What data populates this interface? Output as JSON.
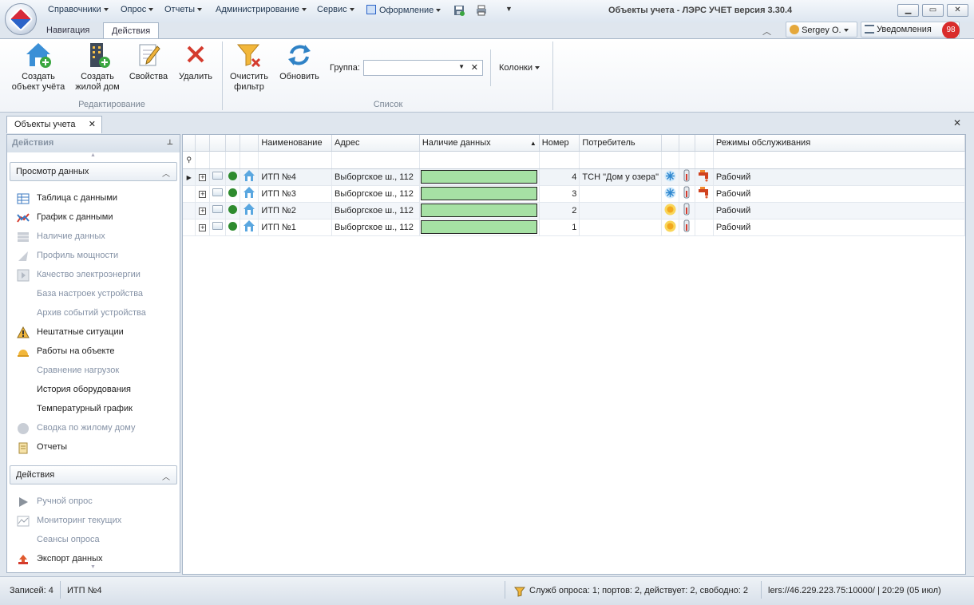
{
  "window": {
    "title": "Объекты учета - ЛЭРС УЧЕТ версия 3.30.4"
  },
  "menu": [
    "Справочники",
    "Опрос",
    "Отчеты",
    "Администрирование",
    "Сервис",
    "Оформление"
  ],
  "ribbon_tabs": [
    "Навигация",
    "Действия"
  ],
  "user": {
    "name": "Sergey O.",
    "notifications_label": "Уведомления",
    "notifications_count": "98"
  },
  "ribbon": {
    "create_object": [
      "Создать",
      "объект учёта"
    ],
    "create_house": [
      "Создать",
      "жилой дом"
    ],
    "properties": "Свойства",
    "delete": "Удалить",
    "clear_filter": [
      "Очистить",
      "фильтр"
    ],
    "refresh": "Обновить",
    "group_label": "Группа:",
    "group_value": "",
    "columns": "Колонки",
    "group_edit": "Редактирование",
    "group_list": "Список"
  },
  "doc_tab": {
    "label": "Объекты учета"
  },
  "left_panel": {
    "header": "Действия",
    "section_view": "Просмотр данных",
    "view_items": [
      {
        "label": "Таблица с данными",
        "icon": "table-icon",
        "enabled": true
      },
      {
        "label": "График с данными",
        "icon": "chart-icon",
        "enabled": true
      },
      {
        "label": "Наличие данных",
        "icon": "data-availability-icon",
        "enabled": false
      },
      {
        "label": "Профиль мощности",
        "icon": "power-profile-icon",
        "enabled": false
      },
      {
        "label": "Качество электроэнергии",
        "icon": "power-quality-icon",
        "enabled": false
      },
      {
        "label": "База настроек устройства",
        "icon": "",
        "enabled": false
      },
      {
        "label": "Архив событий устройства",
        "icon": "",
        "enabled": false
      },
      {
        "label": "Нештатные ситуации",
        "icon": "warning-icon",
        "enabled": true
      },
      {
        "label": "Работы на объекте",
        "icon": "hardhat-icon",
        "enabled": true
      },
      {
        "label": "Сравнение нагрузок",
        "icon": "",
        "enabled": false
      },
      {
        "label": "История оборудования",
        "icon": "",
        "enabled": true
      },
      {
        "label": "Температурный график",
        "icon": "",
        "enabled": true
      },
      {
        "label": "Сводка по жилому дому",
        "icon": "house-summary-icon",
        "enabled": false
      },
      {
        "label": "Отчеты",
        "icon": "report-icon",
        "enabled": true
      }
    ],
    "section_actions": "Действия",
    "action_items": [
      {
        "label": "Ручной опрос",
        "icon": "play-icon",
        "enabled": false
      },
      {
        "label": "Мониторинг текущих",
        "icon": "monitoring-icon",
        "enabled": false
      },
      {
        "label": "Сеансы опроса",
        "icon": "",
        "enabled": false
      },
      {
        "label": "Экспорт данных",
        "icon": "export-icon",
        "enabled": true
      }
    ]
  },
  "grid": {
    "columns": [
      "Наименование",
      "Адрес",
      "Наличие данных",
      "Номер",
      "Потребитель",
      "Режимы обслуживания"
    ],
    "rows": [
      {
        "name": "ИТП №4",
        "address": "Выборгское ш., 112",
        "number": "4",
        "consumer": "ТСН \"Дом у озера\"",
        "mode": "Рабочий",
        "season": "winter",
        "has_tap": true,
        "data_fill": 1.0
      },
      {
        "name": "ИТП №3",
        "address": "Выборгское ш., 112",
        "number": "3",
        "consumer": "",
        "mode": "Рабочий",
        "season": "winter",
        "has_tap": true,
        "data_fill": 1.0
      },
      {
        "name": "ИТП №2",
        "address": "Выборгское ш., 112",
        "number": "2",
        "consumer": "",
        "mode": "Рабочий",
        "season": "summer",
        "has_tap": false,
        "data_fill": 1.0
      },
      {
        "name": "ИТП №1",
        "address": "Выборгское ш., 112",
        "number": "1",
        "consumer": "",
        "mode": "Рабочий",
        "season": "summer",
        "has_tap": false,
        "data_fill": 1.0
      }
    ]
  },
  "status": {
    "records": "Записей: 4",
    "selected": "ИТП №4",
    "services": "Служб опроса: 1; портов: 2, действует: 2, свободно: 2",
    "server": "lers://46.229.223.75:10000/ | 20:29 (05 июл)"
  },
  "colors": {
    "accent": "#2b63c8",
    "data_ok": "#a6e1a4",
    "status_ok": "#2e8b2e",
    "badge": "#d92b2b"
  }
}
